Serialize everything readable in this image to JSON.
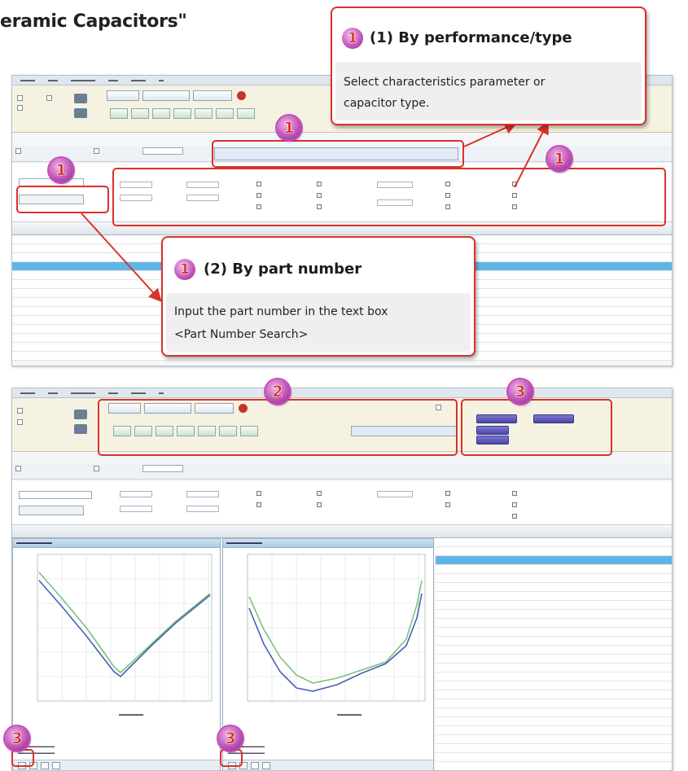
{
  "page": {
    "title": "eramic Capacitors\""
  },
  "callouts": {
    "performance": {
      "badge": "1",
      "title": "(1) By performance/type",
      "line1": "Select characteristics parameter or",
      "line2": "capacitor type."
    },
    "part_number": {
      "badge": "1",
      "title": "(2) By part number",
      "line1": "Input the part number in the text box",
      "line2": "<Part Number Search>"
    }
  },
  "badges": [
    "1",
    "1",
    "1",
    "2",
    "3",
    "3",
    "3"
  ],
  "colors": {
    "highlight_red": "#d9322a",
    "badge_purple": "#b94eb1",
    "selected_row": "#5eb6e6",
    "series_blue": "#4a5fb5",
    "series_green": "#7ec07a"
  },
  "icons": [
    "export-icon",
    "capacitor-icon",
    "arrow-icon",
    "chart-icon",
    "save-icon"
  ]
}
